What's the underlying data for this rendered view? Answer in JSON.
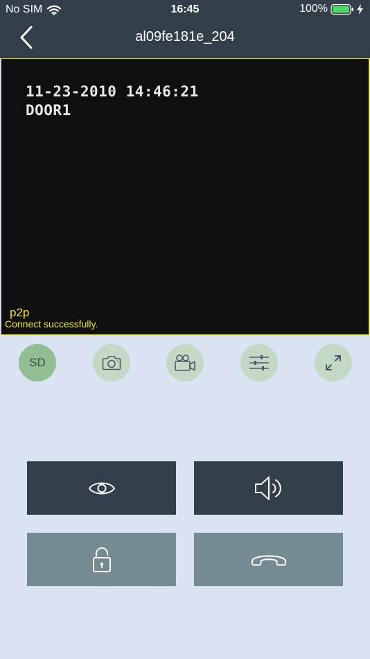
{
  "status_bar": {
    "carrier": "No SIM",
    "time": "16:45",
    "battery_percent": "100%",
    "icons": [
      "wifi-icon",
      "battery-icon",
      "charging-bolt-icon"
    ]
  },
  "nav": {
    "title": "al09fe181e_204",
    "back_icon": "chevron-left-icon"
  },
  "video": {
    "osd_datetime": "11-23-2010 14:46:21",
    "osd_camera": "DOOR1",
    "connection_mode": "p2p",
    "connection_status": "Connect successfully."
  },
  "toolbar": {
    "quality_label": "SD",
    "icons": [
      "snapshot-camera-icon",
      "video-record-icon",
      "settings-sliders-icon",
      "fullscreen-expand-icon"
    ]
  },
  "actions": {
    "icons": [
      "eye-icon",
      "speaker-icon",
      "unlock-icon",
      "hang-up-icon"
    ]
  },
  "colors": {
    "header": "#333e4b",
    "background": "#dae3f2",
    "video_border": "#d8d23a",
    "overlay_text": "#f4ea1c",
    "toolbar_button": "#c3d9c5",
    "toolbar_sd": "#93be93",
    "dark_button": "#333e4b",
    "teal_button": "#738b91"
  }
}
